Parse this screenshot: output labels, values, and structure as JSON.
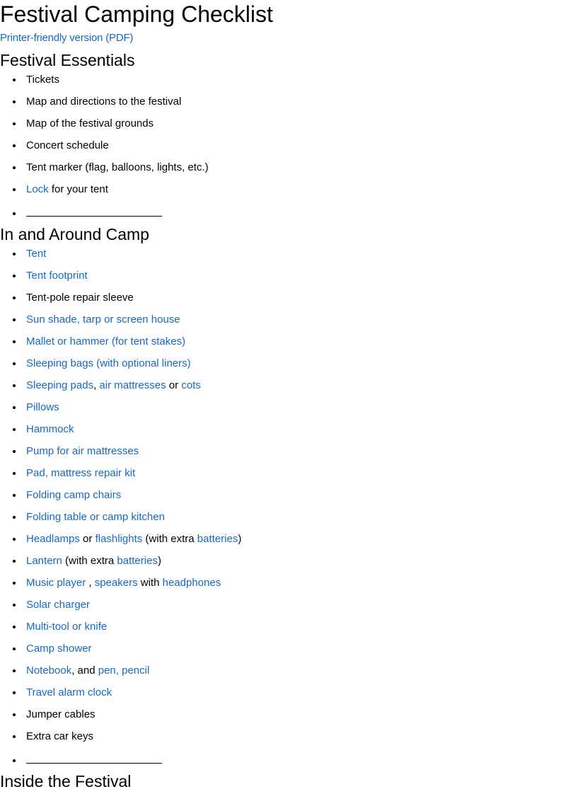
{
  "document": {
    "title": "Festival Camping Checklist",
    "pdf_link_label": "Printer-friendly version (PDF)",
    "link_color": "#1569C7",
    "text_color": "#000000",
    "background_color": "#ffffff"
  },
  "sections": [
    {
      "heading": "Festival Essentials",
      "items": [
        {
          "segments": [
            {
              "text": "Tickets",
              "link": false
            }
          ]
        },
        {
          "segments": [
            {
              "text": "Map and directions to the festival",
              "link": false
            }
          ]
        },
        {
          "segments": [
            {
              "text": "Map of the festival grounds",
              "link": false
            }
          ]
        },
        {
          "segments": [
            {
              "text": "Concert schedule",
              "link": false
            }
          ]
        },
        {
          "segments": [
            {
              "text": "Tent marker (flag, balloons, lights, etc.)",
              "link": false
            }
          ]
        },
        {
          "segments": [
            {
              "text": "Lock",
              "link": true
            },
            {
              "text": " for your tent",
              "link": false
            }
          ]
        },
        {
          "blank_rule": true
        }
      ]
    },
    {
      "heading": "In and Around Camp",
      "items": [
        {
          "segments": [
            {
              "text": "Tent",
              "link": true
            }
          ]
        },
        {
          "segments": [
            {
              "text": "Tent footprint",
              "link": true
            }
          ]
        },
        {
          "segments": [
            {
              "text": "Tent-pole repair sleeve",
              "link": false
            }
          ]
        },
        {
          "segments": [
            {
              "text": "Sun shade, tarp or screen house",
              "link": true
            }
          ]
        },
        {
          "segments": [
            {
              "text": "Mallet or hammer (for tent stakes)",
              "link": true
            }
          ]
        },
        {
          "segments": [
            {
              "text": "Sleeping bags (with optional liners)",
              "link": true
            }
          ]
        },
        {
          "segments": [
            {
              "text": "Sleeping pads",
              "link": true
            },
            {
              "text": ", ",
              "link": false
            },
            {
              "text": "air mattresses",
              "link": true
            },
            {
              "text": " or ",
              "link": false
            },
            {
              "text": "cots",
              "link": true
            }
          ]
        },
        {
          "segments": [
            {
              "text": "Pillows",
              "link": true
            }
          ]
        },
        {
          "segments": [
            {
              "text": "Hammock",
              "link": true
            }
          ]
        },
        {
          "segments": [
            {
              "text": "Pump for air mattresses",
              "link": true
            }
          ]
        },
        {
          "segments": [
            {
              "text": "Pad, mattress repair kit",
              "link": true
            }
          ]
        },
        {
          "segments": [
            {
              "text": "Folding camp chairs",
              "link": true
            }
          ]
        },
        {
          "segments": [
            {
              "text": "Folding table or camp kitchen",
              "link": true
            }
          ]
        },
        {
          "segments": [
            {
              "text": "Headlamps",
              "link": true
            },
            {
              "text": " or ",
              "link": false
            },
            {
              "text": "flashlights",
              "link": true
            },
            {
              "text": " (with extra ",
              "link": false
            },
            {
              "text": "batteries",
              "link": true
            },
            {
              "text": ")",
              "link": false
            }
          ]
        },
        {
          "segments": [
            {
              "text": "Lantern",
              "link": true
            },
            {
              "text": " (with extra ",
              "link": false
            },
            {
              "text": "batteries",
              "link": true
            },
            {
              "text": ")",
              "link": false
            }
          ]
        },
        {
          "segments": [
            {
              "text": "Music player",
              "link": true
            },
            {
              "text": " , ",
              "link": false
            },
            {
              "text": "speakers",
              "link": true
            },
            {
              "text": " with ",
              "link": false
            },
            {
              "text": "headphones",
              "link": true
            }
          ]
        },
        {
          "segments": [
            {
              "text": "Solar charger",
              "link": true
            }
          ]
        },
        {
          "segments": [
            {
              "text": "Multi-tool or knife",
              "link": true
            }
          ]
        },
        {
          "segments": [
            {
              "text": "Camp shower",
              "link": true
            }
          ]
        },
        {
          "segments": [
            {
              "text": "Notebook",
              "link": true
            },
            {
              "text": ", and ",
              "link": false
            },
            {
              "text": "pen, pencil",
              "link": true
            }
          ]
        },
        {
          "segments": [
            {
              "text": "Travel alarm clock",
              "link": true
            }
          ]
        },
        {
          "segments": [
            {
              "text": "Jumper cables",
              "link": false
            }
          ]
        },
        {
          "segments": [
            {
              "text": "Extra car keys",
              "link": false
            }
          ]
        },
        {
          "blank_rule": true
        }
      ]
    }
  ],
  "cut_off_heading": "Inside the Festival"
}
